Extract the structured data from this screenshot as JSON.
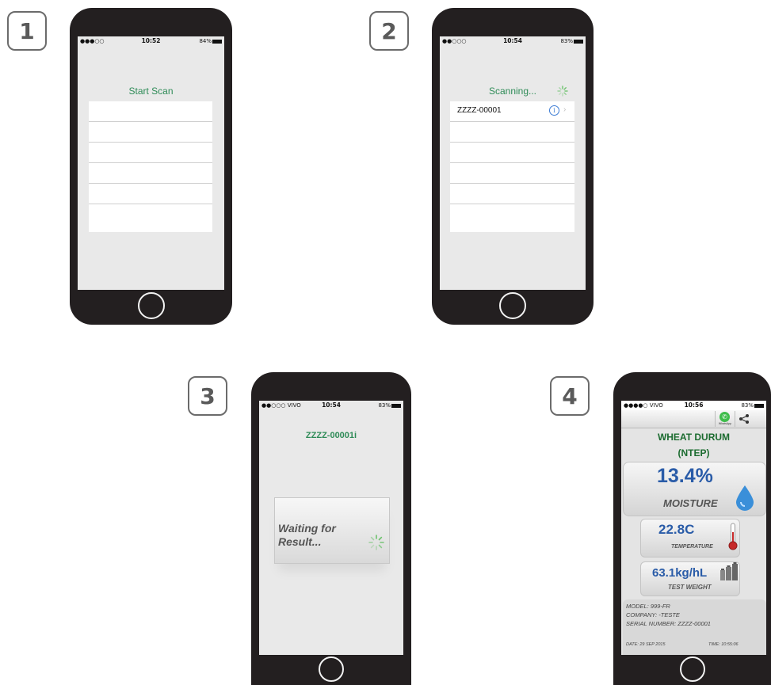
{
  "steps": [
    "1",
    "2",
    "3",
    "4"
  ],
  "status": {
    "p1": {
      "carrier": "●●●○○",
      "time": "10:52",
      "battery": "84%"
    },
    "p2": {
      "carrier": "●●○○○",
      "time": "10:54",
      "battery": "83%"
    },
    "p3": {
      "carrier": "●●○○○ VIVO",
      "time": "10:54",
      "battery": "83%"
    },
    "p4": {
      "carrier": "●●●●○ VIVO",
      "time": "10:56",
      "battery": "83%"
    }
  },
  "phone1": {
    "title": "Start Scan"
  },
  "phone2": {
    "title": "Scanning...",
    "device": "ZZZZ-00001"
  },
  "phone3": {
    "title": "ZZZZ-00001i",
    "waiting": "Waiting for Result..."
  },
  "phone4": {
    "whatsapp_label": "WhatsApp",
    "product": "WHEAT DURUM",
    "standard": "(NTEP)",
    "moisture_value": "13.4%",
    "moisture_label": "MOISTURE",
    "temperature_value": "22.8C",
    "temperature_label": "TEMPERATURE",
    "weight_value": "63.1kg/hL",
    "weight_label": "TEST WEIGHT",
    "model": "MODEL: 999-FR",
    "company": "COMPANY: -TESTE",
    "serial": "SERIAL NUMBER: ZZZZ-00001",
    "date": "DATE: 29 SEP 2015",
    "time": "TIME: 10:55:06"
  },
  "colors": {
    "accent": "#2e8b57",
    "blue": "#2a5ca8",
    "phone": "#231f20"
  }
}
